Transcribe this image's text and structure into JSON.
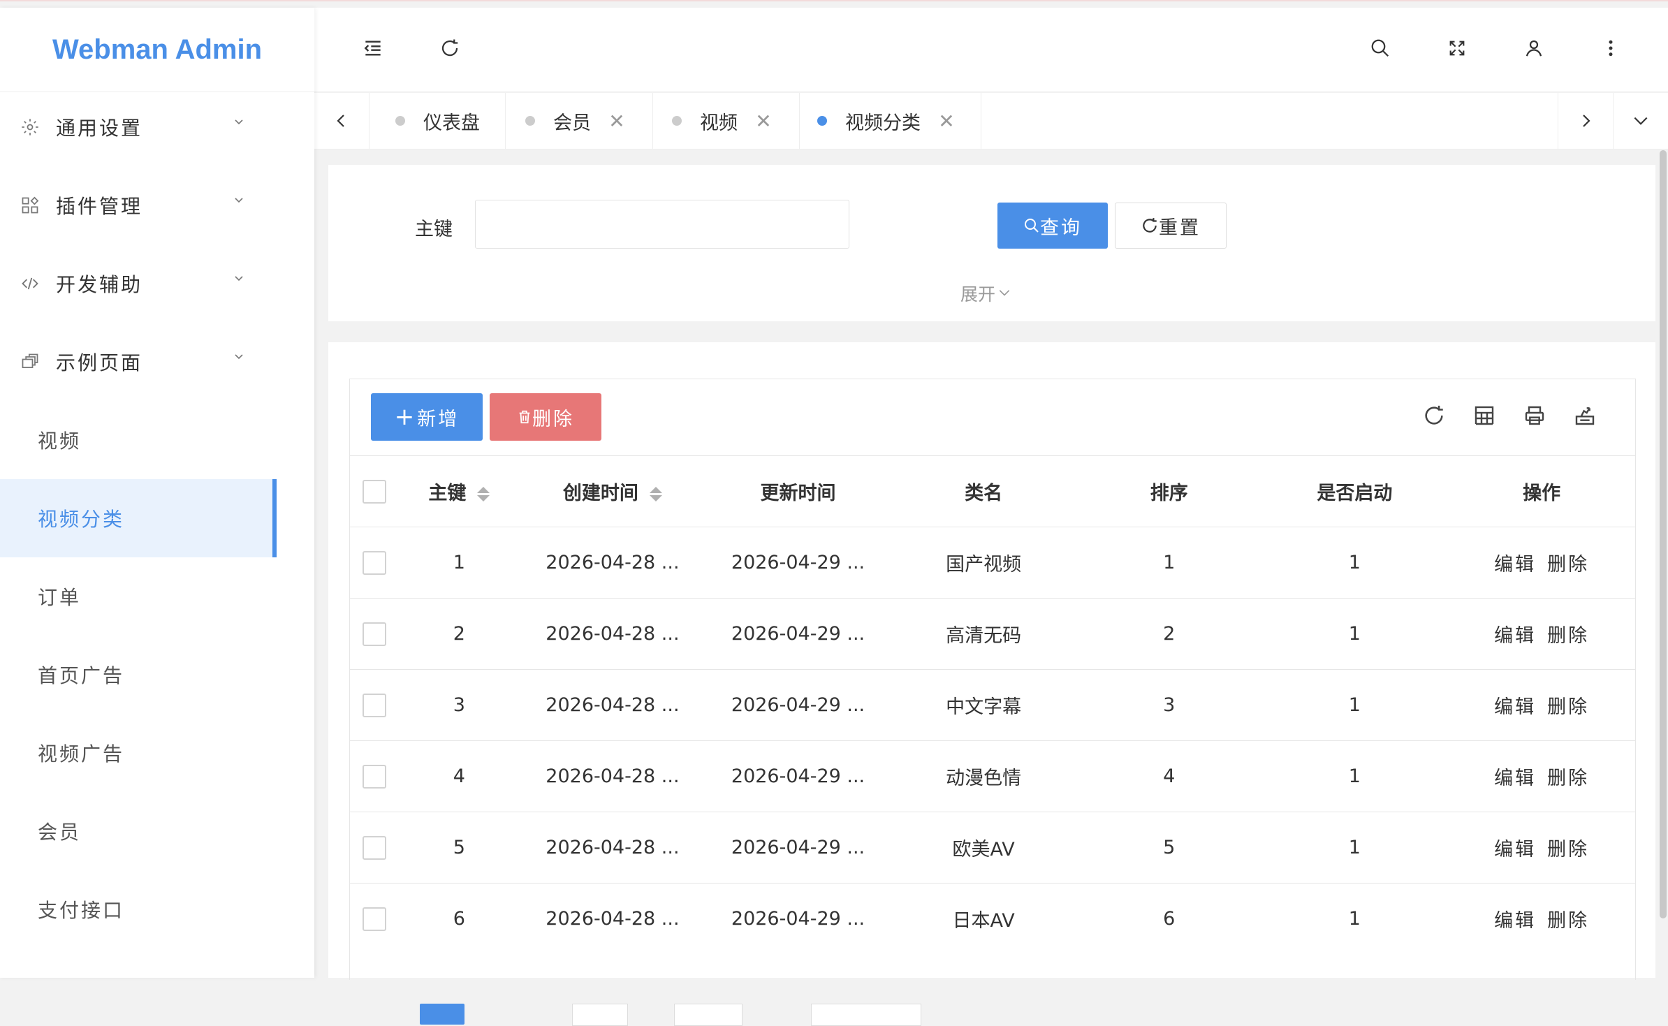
{
  "app": {
    "title": "Webman Admin"
  },
  "sidebar": {
    "groups": [
      {
        "label": "通用设置",
        "icon": "gear-icon"
      },
      {
        "label": "插件管理",
        "icon": "apps-icon"
      },
      {
        "label": "开发辅助",
        "icon": "code-icon"
      },
      {
        "label": "示例页面",
        "icon": "pages-icon"
      }
    ],
    "items": [
      {
        "label": "视频"
      },
      {
        "label": "视频分类",
        "active": true
      },
      {
        "label": "订单"
      },
      {
        "label": "首页广告"
      },
      {
        "label": "视频广告"
      },
      {
        "label": "会员"
      },
      {
        "label": "支付接口"
      }
    ]
  },
  "tabs": [
    {
      "label": "仪表盘",
      "closable": false
    },
    {
      "label": "会员",
      "closable": true
    },
    {
      "label": "视频",
      "closable": true
    },
    {
      "label": "视频分类",
      "closable": true,
      "active": true
    }
  ],
  "search": {
    "field_label": "主键",
    "field_value": "",
    "query_label": "查询",
    "reset_label": "重置",
    "expand_label": "展开"
  },
  "toolbar": {
    "add_label": "新增",
    "delete_label": "删除"
  },
  "table": {
    "headers": [
      "主键",
      "创建时间",
      "更新时间",
      "类名",
      "排序",
      "是否启动",
      "操作"
    ],
    "rows": [
      {
        "id": "1",
        "created": "2026-04-28 ...",
        "updated": "2026-04-29 ...",
        "name": "国产视频",
        "sort": "1",
        "enabled": "1"
      },
      {
        "id": "2",
        "created": "2026-04-28 ...",
        "updated": "2026-04-29 ...",
        "name": "高清无码",
        "sort": "2",
        "enabled": "1"
      },
      {
        "id": "3",
        "created": "2026-04-28 ...",
        "updated": "2026-04-29 ...",
        "name": "中文字幕",
        "sort": "3",
        "enabled": "1"
      },
      {
        "id": "4",
        "created": "2026-04-28 ...",
        "updated": "2026-04-29 ...",
        "name": "动漫色情",
        "sort": "4",
        "enabled": "1"
      },
      {
        "id": "5",
        "created": "2026-04-28 ...",
        "updated": "2026-04-29 ...",
        "name": "欧美AV",
        "sort": "5",
        "enabled": "1"
      },
      {
        "id": "6",
        "created": "2026-04-28 ...",
        "updated": "2026-04-29 ...",
        "name": "日本AV",
        "sort": "6",
        "enabled": "1"
      }
    ],
    "edit_label": "编辑",
    "delete_label": "删除"
  },
  "colors": {
    "accent": "#4a8fe7",
    "danger": "#e77777"
  }
}
